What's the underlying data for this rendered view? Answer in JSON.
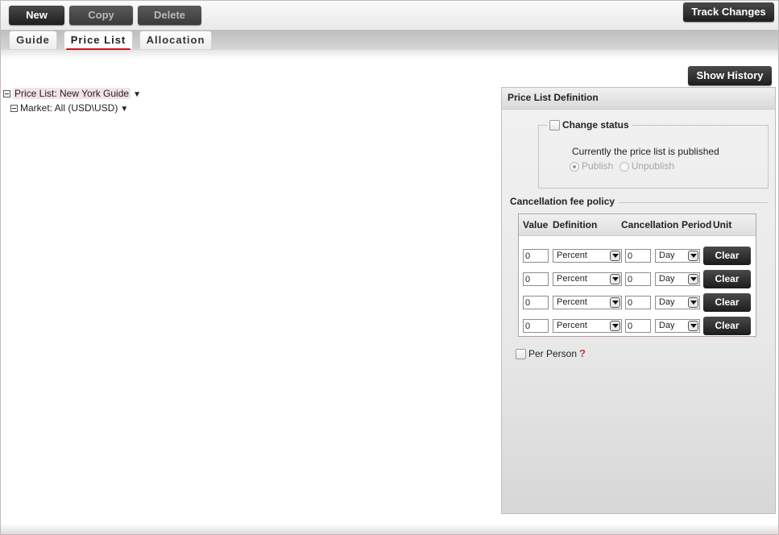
{
  "toolbar": {
    "new_label": "New",
    "copy_label": "Copy",
    "delete_label": "Delete",
    "track_changes_label": "Track Changes"
  },
  "tabs": [
    {
      "label": "Guide"
    },
    {
      "label": "Price List",
      "active": true
    },
    {
      "label": "Allocation"
    }
  ],
  "tree": {
    "root_label": "Price List: New York Guide",
    "child_label": "Market: All (USD\\USD)"
  },
  "show_history_label": "Show History",
  "panel": {
    "title": "Price List Definition",
    "change_status": {
      "legend": "Change status",
      "status_text": "Currently the price list is published",
      "publish_label": "Publish",
      "unpublish_label": "Unpublish",
      "selected": "Publish"
    },
    "cancellation": {
      "title": "Cancellation fee policy",
      "headers": {
        "value": "Value",
        "definition": "Definition",
        "cancellation": "Cancellation",
        "period": "Period",
        "unit": "Unit"
      },
      "rows": [
        {
          "value": "0",
          "definition": "Percent",
          "period": "0",
          "unit": "Day",
          "clear": "Clear"
        },
        {
          "value": "0",
          "definition": "Percent",
          "period": "0",
          "unit": "Day",
          "clear": "Clear"
        },
        {
          "value": "0",
          "definition": "Percent",
          "period": "0",
          "unit": "Day",
          "clear": "Clear"
        },
        {
          "value": "0",
          "definition": "Percent",
          "period": "0",
          "unit": "Day",
          "clear": "Clear"
        }
      ]
    },
    "per_person_label": "Per Person"
  },
  "colors": {
    "accent_red": "#c3161b",
    "button_dark": "#2a2a2a"
  },
  "icons": {
    "help": "question-mark-icon",
    "select_arrow": "chevron-down-icon",
    "tree_collapse": "minus-box-icon"
  }
}
